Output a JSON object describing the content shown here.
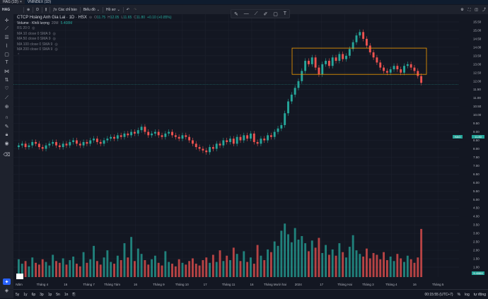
{
  "tabs": [
    {
      "label": "HAG (1D)",
      "active": true
    },
    {
      "label": "VNINDEX (1D)",
      "active": false
    }
  ],
  "toolbar": {
    "symbol": "HAG",
    "interval": "D",
    "indicators": "Các chỉ báo",
    "chart_type": "Biểu đồ",
    "template": "Hồ sơ"
  },
  "legend": {
    "title": "CTCP Hoàng Anh Gia Lai · 1D · HSX",
    "o_label": "O",
    "o": "11.75",
    "h_label": "H",
    "h": "12.05",
    "l_label": "L",
    "l": "11.65",
    "c_label": "C",
    "c": "11.80",
    "change": "+0.10 (+0.85%)",
    "volume_label": "Volume · Khối lượng",
    "volume_a": "20M",
    "volume_b": "5.408M",
    "indicators": [
      "RS 20 0",
      "MA 10 close 0 SMA 9",
      "MA 50 close 0 SMA 9",
      "MA 100 close 0 SMA 9",
      "MA 200 close 0 SMA 9"
    ]
  },
  "price_axis": [
    "15.50",
    "15.00",
    "14.50",
    "14.00",
    "13.50",
    "13.00",
    "12.50",
    "12.00",
    "11.50",
    "11.00",
    "10.50",
    "10.00",
    "9.50",
    "9.00",
    "8.50",
    "8.00",
    "7.50",
    "7.00",
    "6.50",
    "6.00",
    "5.50",
    "5.00",
    "4.50",
    "4.00",
    "3.50",
    "3.00",
    "2.50",
    "2.00",
    "1.50",
    "1.00"
  ],
  "time_axis": [
    "Năm",
    "Tháng 4",
    "16",
    "Tháng 7",
    "Tháng Tám",
    "16",
    "Tháng 9",
    "Tháng 10",
    "17",
    "Tháng 11",
    "16",
    "Tháng Mười hai",
    "2024",
    "17",
    "Tháng Hai",
    "Tháng 3",
    "Tháng 4",
    "16",
    "Tháng 5"
  ],
  "labels": {
    "sym": "HAG",
    "current_price": "11.80",
    "volume_value": "5.408M"
  },
  "bottom": {
    "ranges": [
      "5y",
      "1y",
      "6p",
      "3p",
      "1p",
      "5n",
      "1n"
    ],
    "time": "00:15:55 (UTC+7)",
    "pct": "%",
    "log": "log",
    "auto": "tự động"
  },
  "colors": {
    "up": "#26a69a",
    "down": "#ef5350",
    "rect": "#f59d00"
  },
  "chart_data": {
    "type": "candlestick",
    "ylim": [
      1.0,
      15.5
    ],
    "close": [
      8.2,
      8.3,
      8.1,
      8.2,
      8.4,
      8.3,
      8.1,
      8.0,
      8.2,
      8.3,
      8.4,
      8.2,
      8.1,
      8.3,
      8.2,
      8.4,
      8.5,
      8.3,
      8.2,
      8.4,
      8.3,
      8.5,
      8.6,
      8.4,
      8.3,
      8.5,
      8.6,
      8.7,
      8.6,
      8.8,
      8.7,
      8.9,
      8.8,
      9.0,
      8.9,
      9.1,
      9.3,
      9.0,
      8.8,
      8.9,
      9.0,
      8.8,
      8.7,
      8.9,
      9.0,
      8.8,
      8.7,
      8.6,
      8.8,
      8.7,
      8.5,
      8.3,
      8.1,
      8.0,
      7.9,
      7.8,
      8.1,
      8.0,
      8.3,
      8.2,
      8.5,
      8.4,
      8.6,
      8.3,
      8.7,
      8.5,
      8.8,
      8.6,
      8.9,
      8.4,
      8.3,
      8.6,
      8.5,
      8.8,
      8.7,
      9.0,
      9.2,
      9.4,
      10.1,
      10.8,
      11.2,
      11.6,
      12.0,
      12.6,
      13.2,
      13.0,
      13.4,
      12.8,
      12.4,
      13.0,
      13.2,
      12.9,
      13.4,
      13.2,
      13.6,
      13.3,
      13.5,
      13.9,
      14.3,
      14.7,
      14.9,
      14.5,
      14.1,
      13.7,
      13.4,
      13.1,
      12.8,
      12.6,
      12.5,
      12.7,
      12.9,
      12.7,
      12.5,
      12.9,
      13.0,
      12.8,
      12.6,
      12.3,
      11.9
    ],
    "volume": [
      2.0,
      1.5,
      1.8,
      1.2,
      2.2,
      1.6,
      1.4,
      2.0,
      1.7,
      1.3,
      2.5,
      1.8,
      1.6,
      2.1,
      1.4,
      1.9,
      2.3,
      1.5,
      1.2,
      2.8,
      1.6,
      2.0,
      3.5,
      1.8,
      1.4,
      2.2,
      3.0,
      1.7,
      1.5,
      2.4,
      1.9,
      3.8,
      2.2,
      4.5,
      1.8,
      3.2,
      2.6,
      1.9,
      1.4,
      2.0,
      2.4,
      1.6,
      1.3,
      2.9,
      1.7,
      1.5,
      1.2,
      2.0,
      1.6,
      1.4,
      1.8,
      2.1,
      1.5,
      1.3,
      1.9,
      2.2,
      1.6,
      2.5,
      1.7,
      3.0,
      1.8,
      2.4,
      1.9,
      3.3,
      2.6,
      1.8,
      2.9,
      1.7,
      2.2,
      1.5,
      3.6,
      2.4,
      1.9,
      3.1,
      2.8,
      4.0,
      3.5,
      5.2,
      6.0,
      4.8,
      3.9,
      5.5,
      4.2,
      4.6,
      3.8,
      2.9,
      4.1,
      3.3,
      4.4,
      2.7,
      3.6,
      2.5,
      3.1,
      2.4,
      3.8,
      2.8,
      2.2,
      3.4,
      4.7,
      3.0,
      2.6,
      2.3,
      3.2,
      2.1,
      2.7,
      2.5,
      2.0,
      2.8,
      1.9,
      2.3,
      1.8,
      2.6,
      2.1,
      1.7,
      2.4,
      2.0,
      1.6,
      2.2,
      5.4
    ]
  }
}
